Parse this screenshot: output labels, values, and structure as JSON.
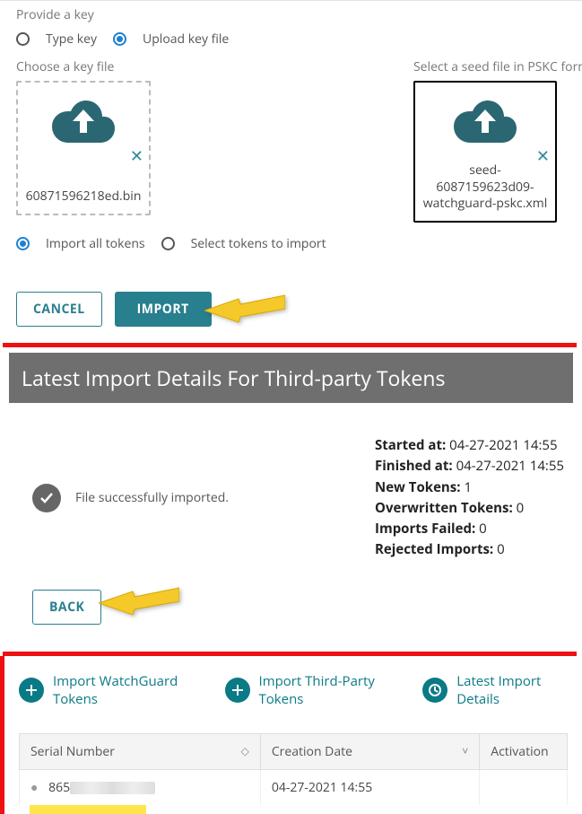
{
  "provideKey": {
    "title": "Provide a key",
    "radios": {
      "type": "Type key",
      "upload": "Upload key file"
    },
    "chooseLabel": "Choose a key file",
    "seedLabel": "Select a seed file in PSKC format",
    "keyFilename": "60871596218ed.bin",
    "seedFilename": "seed-6087159623d09-watchguard-pskc.xml"
  },
  "importMode": {
    "all": "Import all tokens",
    "select": "Select tokens to import"
  },
  "buttons": {
    "cancel": "CANCEL",
    "import": "IMPORT",
    "back": "BACK"
  },
  "details": {
    "header": "Latest Import Details For Third-party Tokens",
    "successMsg": "File successfully imported.",
    "stats": {
      "startedLabel": "Started at:",
      "startedVal": "04-27-2021 14:55",
      "finishedLabel": "Finished at:",
      "finishedVal": "04-27-2021 14:55",
      "newLabel": "New Tokens:",
      "newVal": "1",
      "overwrittenLabel": "Overwritten Tokens:",
      "overwrittenVal": "0",
      "failedLabel": "Imports Failed:",
      "failedVal": "0",
      "rejectedLabel": "Rejected Imports:",
      "rejectedVal": "0"
    }
  },
  "actions": {
    "watchguard": "Import WatchGuard Tokens",
    "thirdparty": "Import Third-Party Tokens",
    "latest": "Latest Import Details"
  },
  "table": {
    "cols": {
      "serial": "Serial Number",
      "creation": "Creation Date",
      "activation": "Activation"
    },
    "row1": {
      "serialPrefix": "865",
      "creation": "04-27-2021 14:55"
    }
  }
}
